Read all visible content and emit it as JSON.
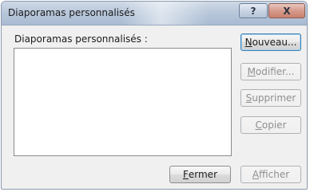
{
  "window": {
    "title": "Diaporamas personnalisés"
  },
  "titlebar_buttons": {
    "help_label": "?",
    "close_label": "X"
  },
  "list": {
    "label": "Diaporamas personnalisés :",
    "items": []
  },
  "buttons": {
    "new": {
      "mnemonic": "N",
      "rest": "ouveau..."
    },
    "modify": {
      "mnemonic": "M",
      "rest": "odifier..."
    },
    "delete": {
      "mnemonic": "S",
      "rest": "upprimer"
    },
    "copy": {
      "mnemonic": "C",
      "rest": "opier"
    },
    "close": {
      "mnemonic": "F",
      "rest": "ermer"
    },
    "show": {
      "mnemonic": "A",
      "rest": "fficher"
    }
  }
}
